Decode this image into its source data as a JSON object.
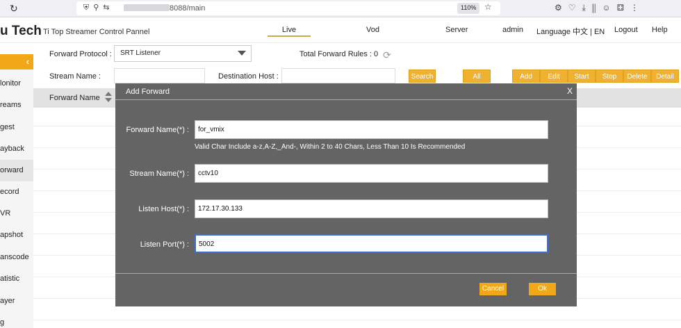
{
  "browser": {
    "url": "8088/main",
    "zoom": "110%"
  },
  "header": {
    "brand": "u Tech",
    "subtitle": "Ti Top Streamer Control Pannel",
    "nav": [
      "Live",
      "Vod",
      "Server",
      "admin",
      "Language 中文 | EN",
      "Logout",
      "Help"
    ]
  },
  "sidebar": {
    "items": [
      "lonitor",
      "reams",
      "gest",
      "ayback",
      "orward",
      "ecord",
      "VR",
      "apshot",
      "anscode",
      "atistic",
      "ayer",
      "g"
    ]
  },
  "controls": {
    "protocol_label": "Forward Protocol :",
    "protocol_value": "SRT Listener",
    "total_rules": "Total Forward Rules : 0",
    "stream_label": "Stream Name :",
    "dest_label": "Destination Host :",
    "buttons": [
      "Search",
      "All",
      "Add",
      "Edit",
      "Start",
      "Stop",
      "Delete",
      "Detail"
    ]
  },
  "table": {
    "col_forward_name": "Forward Name"
  },
  "modal": {
    "title": "Add Forward",
    "close": "X",
    "fields": [
      {
        "label": "Forward Name(*) :",
        "value": "for_vmix"
      },
      {
        "label": "Stream Name(*) :",
        "value": "cctv10"
      },
      {
        "label": "Listen Host(*) :",
        "value": "172.17.30.133"
      },
      {
        "label": "Listen Port(*) :",
        "value": "5002"
      }
    ],
    "hint": "Valid Char Include a-z,A-Z,_And-, Within 2 to 40 Chars, Less Than 10 Is Recommended",
    "cancel": "Cancel",
    "ok": "Ok"
  },
  "colors": {
    "accent": "#f0a818",
    "modal_bg": "#646464",
    "focus": "#3a6fd6"
  }
}
